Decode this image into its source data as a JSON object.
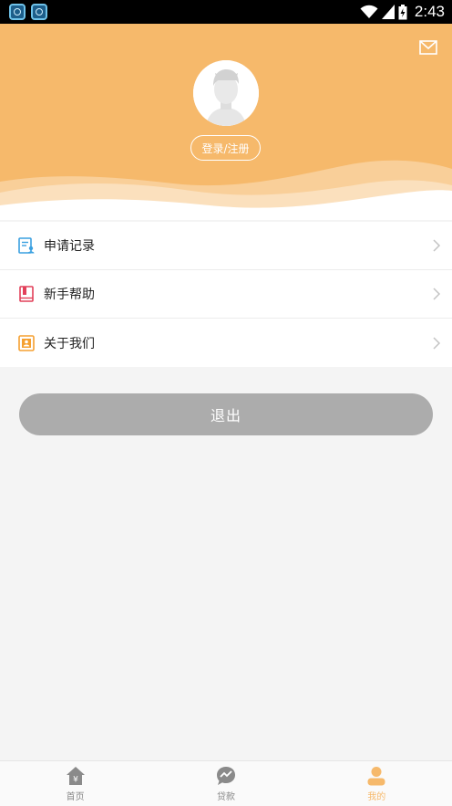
{
  "status_bar": {
    "time": "2:43"
  },
  "header": {
    "login_label": "登录/注册"
  },
  "menu": {
    "items": [
      {
        "label": "申请记录",
        "icon": "application-record-icon",
        "color": "#3aa0e0"
      },
      {
        "label": "新手帮助",
        "icon": "help-book-icon",
        "color": "#e2405a"
      },
      {
        "label": "关于我们",
        "icon": "about-contact-icon",
        "color": "#f5a030"
      }
    ]
  },
  "logout": {
    "label": "退出"
  },
  "tab_bar": {
    "tabs": [
      {
        "label": "首页",
        "icon": "home-icon",
        "active": false
      },
      {
        "label": "贷款",
        "icon": "loan-chat-icon",
        "active": false
      },
      {
        "label": "我的",
        "icon": "profile-icon",
        "active": true
      }
    ]
  },
  "colors": {
    "accent": "#f6b96b",
    "logout_bg": "#acacac",
    "page_bg": "#f4f4f4"
  }
}
